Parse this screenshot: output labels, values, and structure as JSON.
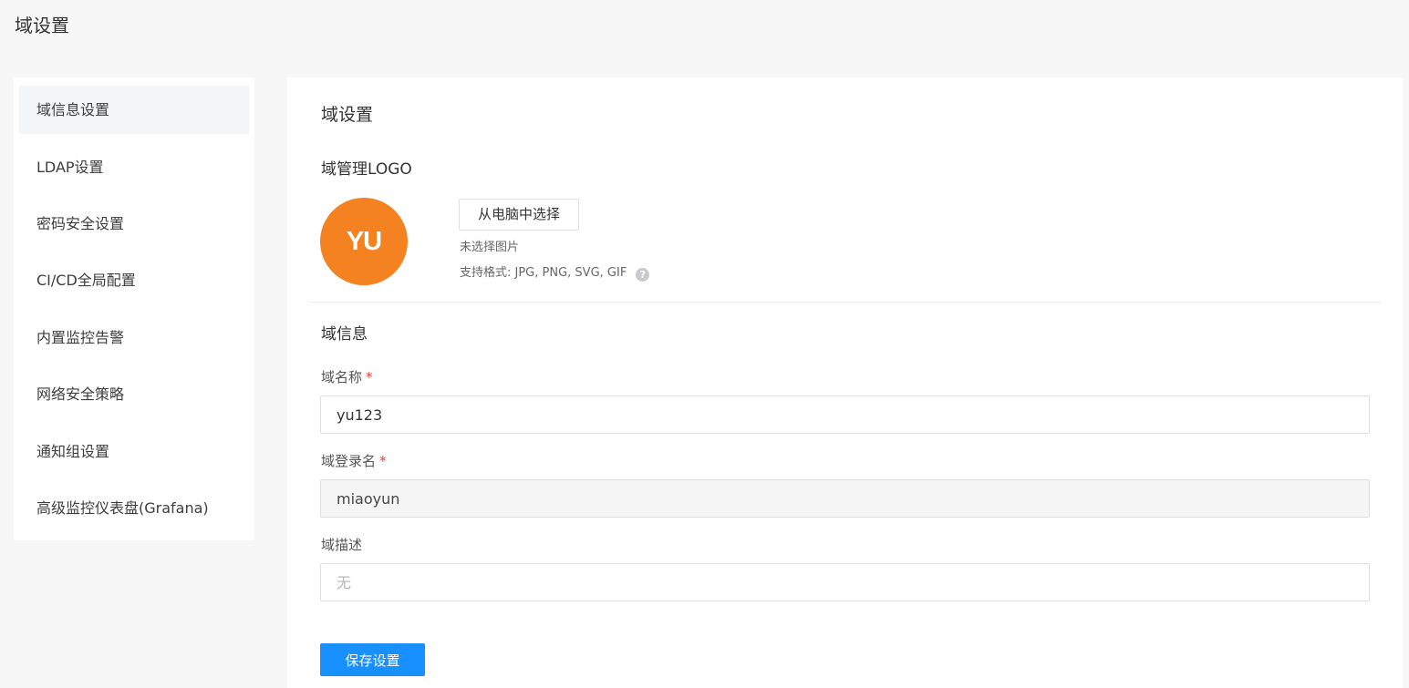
{
  "page": {
    "title": "域设置"
  },
  "sidebar": {
    "items": [
      {
        "label": "域信息设置",
        "active": true
      },
      {
        "label": "LDAP设置"
      },
      {
        "label": "密码安全设置"
      },
      {
        "label": "CI/CD全局配置"
      },
      {
        "label": "内置监控告警"
      },
      {
        "label": "网络安全策略"
      },
      {
        "label": "通知组设置"
      },
      {
        "label": "高级监控仪表盘(Grafana)"
      }
    ]
  },
  "main": {
    "title": "域设置",
    "logo": {
      "title": "域管理LOGO",
      "avatar_text": "YU",
      "avatar_color": "#f58220",
      "upload_label": "从电脑中选择",
      "no_file_text": "未选择图片",
      "format_hint": "支持格式: JPG, PNG, SVG, GIF",
      "help_icon": "question-circle-icon"
    },
    "info": {
      "title": "域信息",
      "name_label": "域名称",
      "name_value": "yu123",
      "login_label": "域登录名",
      "login_value": "miaoyun",
      "desc_label": "域描述",
      "desc_placeholder": "无",
      "required_mark": "*"
    },
    "save_label": "保存设置",
    "accent_color": "#1890ff"
  }
}
